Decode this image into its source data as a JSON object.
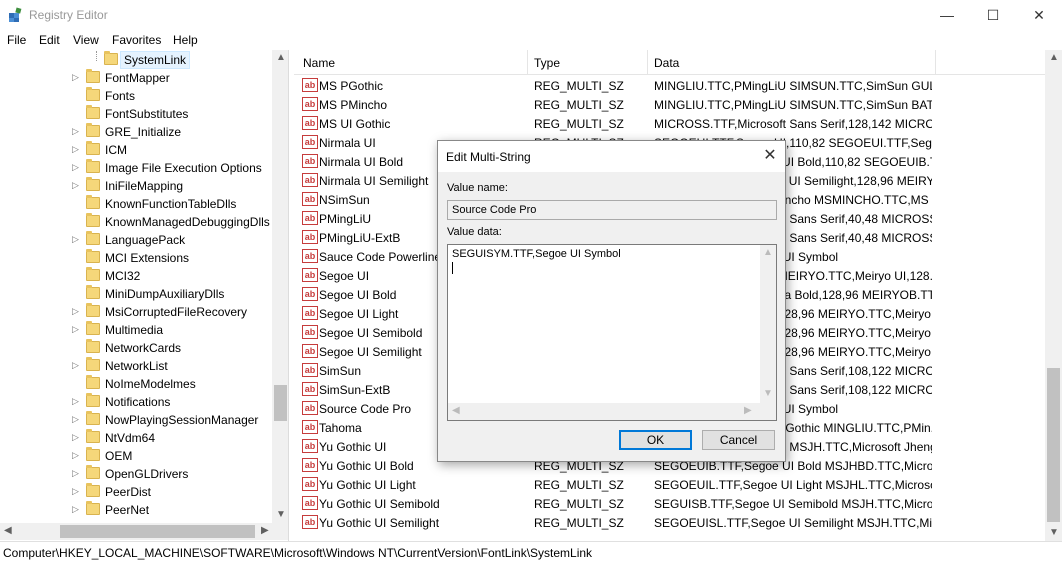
{
  "window": {
    "title": "Registry Editor",
    "minimize_glyph": "—",
    "maximize_glyph": "☐",
    "close_glyph": "✕"
  },
  "menu": [
    "File",
    "Edit",
    "View",
    "Favorites",
    "Help"
  ],
  "tree": {
    "items": [
      {
        "label": "SystemLink",
        "selected": true,
        "expandable": false
      },
      {
        "label": "FontMapper",
        "selected": false,
        "expandable": true
      },
      {
        "label": "Fonts",
        "selected": false,
        "expandable": false
      },
      {
        "label": "FontSubstitutes",
        "selected": false,
        "expandable": false
      },
      {
        "label": "GRE_Initialize",
        "selected": false,
        "expandable": true
      },
      {
        "label": "ICM",
        "selected": false,
        "expandable": true
      },
      {
        "label": "Image File Execution Options",
        "selected": false,
        "expandable": true
      },
      {
        "label": "IniFileMapping",
        "selected": false,
        "expandable": true
      },
      {
        "label": "KnownFunctionTableDlls",
        "selected": false,
        "expandable": false
      },
      {
        "label": "KnownManagedDebuggingDlls",
        "selected": false,
        "expandable": false
      },
      {
        "label": "LanguagePack",
        "selected": false,
        "expandable": true
      },
      {
        "label": "MCI Extensions",
        "selected": false,
        "expandable": false
      },
      {
        "label": "MCI32",
        "selected": false,
        "expandable": false
      },
      {
        "label": "MiniDumpAuxiliaryDlls",
        "selected": false,
        "expandable": false
      },
      {
        "label": "MsiCorruptedFileRecovery",
        "selected": false,
        "expandable": true
      },
      {
        "label": "Multimedia",
        "selected": false,
        "expandable": true
      },
      {
        "label": "NetworkCards",
        "selected": false,
        "expandable": false
      },
      {
        "label": "NetworkList",
        "selected": false,
        "expandable": true
      },
      {
        "label": "NoImeModelmes",
        "selected": false,
        "expandable": false
      },
      {
        "label": "Notifications",
        "selected": false,
        "expandable": true
      },
      {
        "label": "NowPlayingSessionManager",
        "selected": false,
        "expandable": true
      },
      {
        "label": "NtVdm64",
        "selected": false,
        "expandable": true
      },
      {
        "label": "OEM",
        "selected": false,
        "expandable": true
      },
      {
        "label": "OpenGLDrivers",
        "selected": false,
        "expandable": true
      },
      {
        "label": "PeerDist",
        "selected": false,
        "expandable": true
      },
      {
        "label": "PeerNet",
        "selected": false,
        "expandable": true
      }
    ]
  },
  "list": {
    "columns": [
      "Name",
      "Type",
      "Data"
    ],
    "rows": [
      {
        "name": "MS PGothic",
        "type": "REG_MULTI_SZ",
        "data": "MINGLIU.TTC,PMingLiU SIMSUN.TTC,SimSun GUL..."
      },
      {
        "name": "MS PMincho",
        "type": "REG_MULTI_SZ",
        "data": "MINGLIU.TTC,PMingLiU SIMSUN.TTC,SimSun BAT..."
      },
      {
        "name": "MS UI Gothic",
        "type": "REG_MULTI_SZ",
        "data": "MICROSS.TTF,Microsoft Sans Serif,128,142 MICRO..."
      },
      {
        "name": "Nirmala UI",
        "type": "REG_MULTI_SZ",
        "data": "SEGOEUI.TTF,Segoe UI,110,82 SEGOEUI.TTF,Segoe ..."
      },
      {
        "name": "Nirmala UI Bold",
        "type": "REG_MULTI_SZ",
        "data": "SEGOEUIB.TTF,Segoe UI Bold,110,82 SEGOEUIB.TTF..."
      },
      {
        "name": "Nirmala UI Semilight",
        "type": "REG_MULTI_SZ",
        "data": "SEGOEUISL.TTF,Segoe UI Semilight,128,96 MEIRYO.TTC,Meiryo..."
      },
      {
        "name": "NSimSun",
        "type": "REG_MULTI_SZ",
        "data": "MSMINCHO.TTC,MS Mincho MSMINCHO.TTC,MS Min..."
      },
      {
        "name": "PMingLiU",
        "type": "REG_MULTI_SZ",
        "data": "MICROSS.TTF,Microsoft Sans Serif,40,48 MICROSS..."
      },
      {
        "name": "PMingLiU-ExtB",
        "type": "REG_MULTI_SZ",
        "data": "MICROSS.TTF,Microsoft Sans Serif,40,48 MICROSS..."
      },
      {
        "name": "Sauce Code Powerline",
        "type": "REG_MULTI_SZ",
        "data": "SEGUISYM.TTF,Segoe UI Symbol"
      },
      {
        "name": "Segoe UI",
        "type": "REG_MULTI_SZ",
        "data": "TAHOMA.TTF,Tahoma MEIRYO.TTC,Meiryo UI,128..."
      },
      {
        "name": "Segoe UI Bold",
        "type": "REG_MULTI_SZ",
        "data": "TAHOMABD.TTF,Tahoma Bold,128,96 MEIRYOB.TT..."
      },
      {
        "name": "Segoe UI Light",
        "type": "REG_MULTI_SZ",
        "data": "TAHOMA.TTF,Tahoma,128,96 MEIRYO.TTC,Meiryo..."
      },
      {
        "name": "Segoe UI Semibold",
        "type": "REG_MULTI_SZ",
        "data": "TAHOMA.TTF,Tahoma,128,96 MEIRYO.TTC,Meiryo..."
      },
      {
        "name": "Segoe UI Semilight",
        "type": "REG_MULTI_SZ",
        "data": "TAHOMA.TTF,Tahoma,128,96 MEIRYO.TTC,Meiryo..."
      },
      {
        "name": "SimSun",
        "type": "REG_MULTI_SZ",
        "data": "MICROSS.TTF,Microsoft Sans Serif,108,122 MICRO..."
      },
      {
        "name": "SimSun-ExtB",
        "type": "REG_MULTI_SZ",
        "data": "MICROSS.TTF,Microsoft Sans Serif,108,122 MICRO..."
      },
      {
        "name": "Source Code Pro",
        "type": "REG_MULTI_SZ",
        "data": "SEGUISYM.TTF,Segoe UI Symbol"
      },
      {
        "name": "Tahoma",
        "type": "REG_MULTI_SZ",
        "data": "MSGOTHIC.TTC,MS UI Gothic MINGLIU.TTC,PMin..."
      },
      {
        "name": "Yu Gothic UI",
        "type": "REG_MULTI_SZ",
        "data": "SEGOEUI.TTF,Segoe UI MSJH.TTC,Microsoft Jheng..."
      },
      {
        "name": "Yu Gothic UI Bold",
        "type": "REG_MULTI_SZ",
        "data": "SEGOEUIB.TTF,Segoe UI Bold MSJHBD.TTC,Micros..."
      },
      {
        "name": "Yu Gothic UI Light",
        "type": "REG_MULTI_SZ",
        "data": "SEGOEUIL.TTF,Segoe UI Light MSJHL.TTC,Microsof..."
      },
      {
        "name": "Yu Gothic UI Semibold",
        "type": "REG_MULTI_SZ",
        "data": "SEGUISB.TTF,Segoe UI Semibold MSJH.TTC,Micros..."
      },
      {
        "name": "Yu Gothic UI Semilight",
        "type": "REG_MULTI_SZ",
        "data": "SEGOEUISL.TTF,Segoe UI Semilight MSJH.TTC,Micr..."
      }
    ]
  },
  "status": {
    "path": "Computer\\HKEY_LOCAL_MACHINE\\SOFTWARE\\Microsoft\\Windows NT\\CurrentVersion\\FontLink\\SystemLink"
  },
  "dialog": {
    "title": "Edit Multi-String",
    "close_glyph": "✕",
    "value_name_label": "Value name:",
    "value_name": "Source Code Pro",
    "value_data_label": "Value data:",
    "value_data": "SEGUISYM.TTF,Segoe UI Symbol",
    "ok_label": "OK",
    "cancel_label": "Cancel"
  },
  "colors": {
    "selection_bg": "#e5f3ff",
    "ok_border": "#0078d7",
    "string_icon": "#c63c3c",
    "folder": "#f5d77a"
  }
}
